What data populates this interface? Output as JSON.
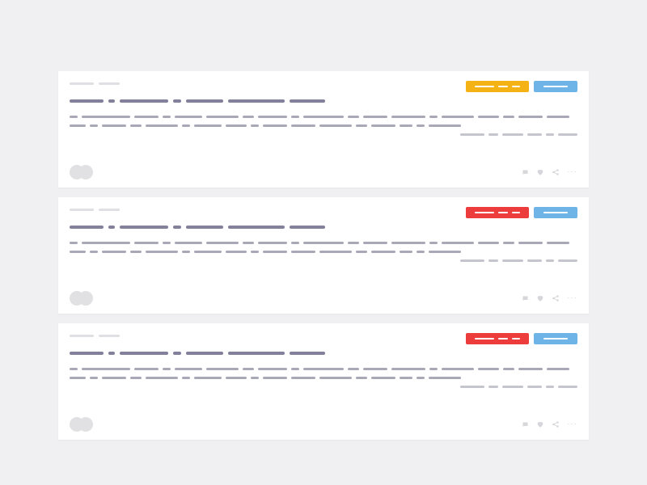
{
  "cards": [
    {
      "badge_primary_color": "yellow",
      "badge_primary_seg_widths": [
        24,
        12,
        10
      ],
      "badge_secondary_seg_widths": [
        30
      ],
      "meta_seg_widths": [
        30,
        26
      ],
      "title_seg_widths": [
        42,
        8,
        60,
        10,
        46,
        70,
        44
      ],
      "body_rows": [
        [
          10,
          60,
          30,
          10,
          34,
          40,
          14,
          36,
          10,
          50,
          14,
          30,
          42,
          10,
          40,
          26,
          14,
          30,
          28
        ],
        [
          20,
          10,
          30,
          14,
          40,
          10,
          34,
          26,
          10,
          30,
          30,
          40,
          14,
          30,
          16,
          10,
          40
        ]
      ],
      "tail_seg_widths": [
        30,
        12,
        26,
        18,
        10,
        24
      ],
      "comment_label": "comment",
      "like_label": "like",
      "share_label": "share",
      "more_label": "more"
    },
    {
      "badge_primary_color": "red",
      "badge_primary_seg_widths": [
        24,
        12,
        10
      ],
      "badge_secondary_seg_widths": [
        30
      ],
      "meta_seg_widths": [
        30,
        26
      ],
      "title_seg_widths": [
        42,
        8,
        60,
        10,
        46,
        70,
        44
      ],
      "body_rows": [
        [
          10,
          60,
          30,
          10,
          34,
          40,
          14,
          36,
          10,
          50,
          14,
          30,
          42,
          10,
          40,
          26,
          14,
          30,
          28
        ],
        [
          20,
          10,
          30,
          14,
          40,
          10,
          34,
          26,
          10,
          30,
          30,
          40,
          14,
          30,
          16,
          10,
          40
        ]
      ],
      "tail_seg_widths": [
        30,
        12,
        26,
        18,
        10,
        24
      ],
      "comment_label": "comment",
      "like_label": "like",
      "share_label": "share",
      "more_label": "more"
    },
    {
      "badge_primary_color": "red",
      "badge_primary_seg_widths": [
        24,
        12,
        10
      ],
      "badge_secondary_seg_widths": [
        30
      ],
      "meta_seg_widths": [
        30,
        26
      ],
      "title_seg_widths": [
        42,
        8,
        60,
        10,
        46,
        70,
        44
      ],
      "body_rows": [
        [
          10,
          60,
          30,
          10,
          34,
          40,
          14,
          36,
          10,
          50,
          14,
          30,
          42,
          10,
          40,
          26,
          14,
          30,
          28
        ],
        [
          20,
          10,
          30,
          14,
          40,
          10,
          34,
          26,
          10,
          30,
          30,
          40,
          14,
          30,
          16,
          10,
          40
        ]
      ],
      "tail_seg_widths": [
        30,
        12,
        26,
        18,
        10,
        24
      ],
      "comment_label": "comment",
      "like_label": "like",
      "share_label": "share",
      "more_label": "more"
    }
  ]
}
